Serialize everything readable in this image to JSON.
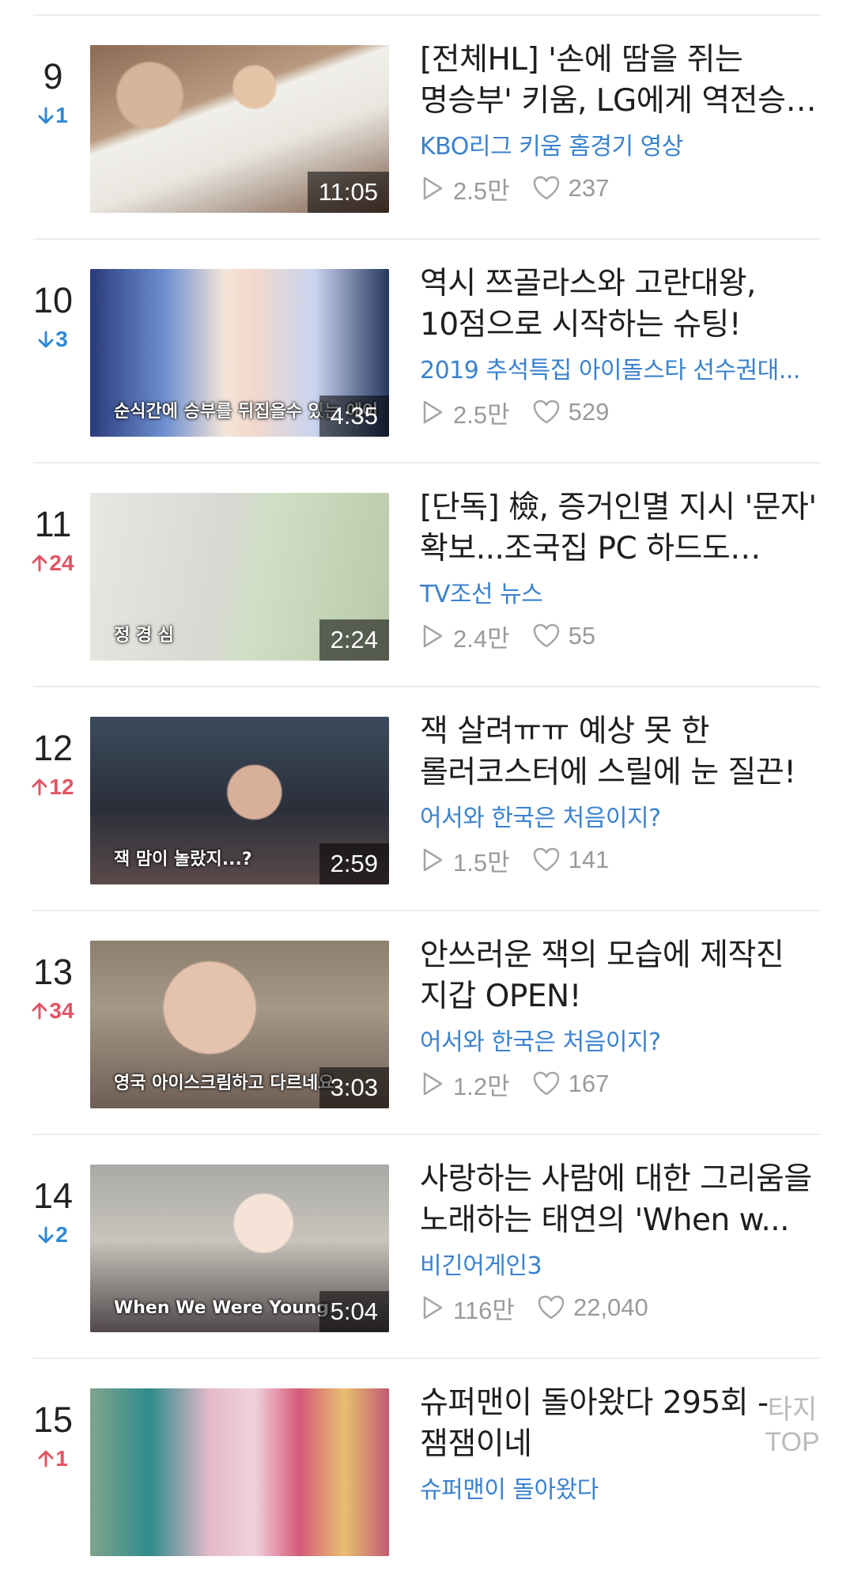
{
  "items": [
    {
      "rank": "9",
      "change": "1",
      "direction": "down",
      "title": "[전체HL] '손에 땀을 쥐는 명승부' 키움, LG에게 역전승 거두...",
      "channel": "KBO리그 키움 홈경기 영상",
      "views": "2.5만",
      "likes": "237",
      "duration": "11:05",
      "thumb_caption": ""
    },
    {
      "rank": "10",
      "change": "3",
      "direction": "down",
      "title": "역시 쯔골라스와 고란대왕, 10점으로 시작하는 슈팅!",
      "channel": "2019 추석특집 아이돌스타 선수권대...",
      "views": "2.5만",
      "likes": "529",
      "duration": "4:35",
      "thumb_caption": "순식간에 승부를 뒤집을수 있는 에이"
    },
    {
      "rank": "11",
      "change": "24",
      "direction": "up",
      "title": "[단독] 檢, 증거인멸 지시 '문자' 확보...조국집 PC 하드도 전격...",
      "channel": "TV조선 뉴스",
      "views": "2.4만",
      "likes": "55",
      "duration": "2:24",
      "thumb_caption": "정 경 심"
    },
    {
      "rank": "12",
      "change": "12",
      "direction": "up",
      "title": "잭 살려ㅠㅠ 예상 못 한 롤러코스터에 스릴에 눈 질끈!",
      "channel": "어서와 한국은 처음이지?",
      "views": "1.5만",
      "likes": "141",
      "duration": "2:59",
      "thumb_caption": "잭 맘이 놀랐지...?"
    },
    {
      "rank": "13",
      "change": "34",
      "direction": "up",
      "title": "안쓰러운 잭의 모습에 제작진 지갑 OPEN!",
      "channel": "어서와 한국은 처음이지?",
      "views": "1.2만",
      "likes": "167",
      "duration": "3:03",
      "thumb_caption": "영국 아이스크림하고 다르네요"
    },
    {
      "rank": "14",
      "change": "2",
      "direction": "down",
      "title": "사랑하는 사람에 대한 그리움을 노래하는 태연의 'When w...",
      "channel": "비긴어게인3",
      "views": "116만",
      "likes": "22,040",
      "duration": "5:04",
      "thumb_caption": "When We Were Young"
    },
    {
      "rank": "15",
      "change": "1",
      "direction": "up",
      "title": "슈퍼맨이 돌아왔다 295회 - 잼잼이네",
      "channel": "슈퍼맨이 돌아왔다",
      "views": "",
      "likes": "",
      "duration": "",
      "thumb_caption": ""
    }
  ],
  "top_button": {
    "title": "타지",
    "label": "TOP"
  },
  "colors": {
    "up": "#e25564",
    "down": "#2f89d4",
    "channel": "#3a82cf",
    "meta": "#9a9a9a"
  },
  "icons": {
    "views": "play-outline-icon",
    "likes": "heart-outline-icon",
    "up": "arrow-up-icon",
    "down": "arrow-down-icon"
  }
}
